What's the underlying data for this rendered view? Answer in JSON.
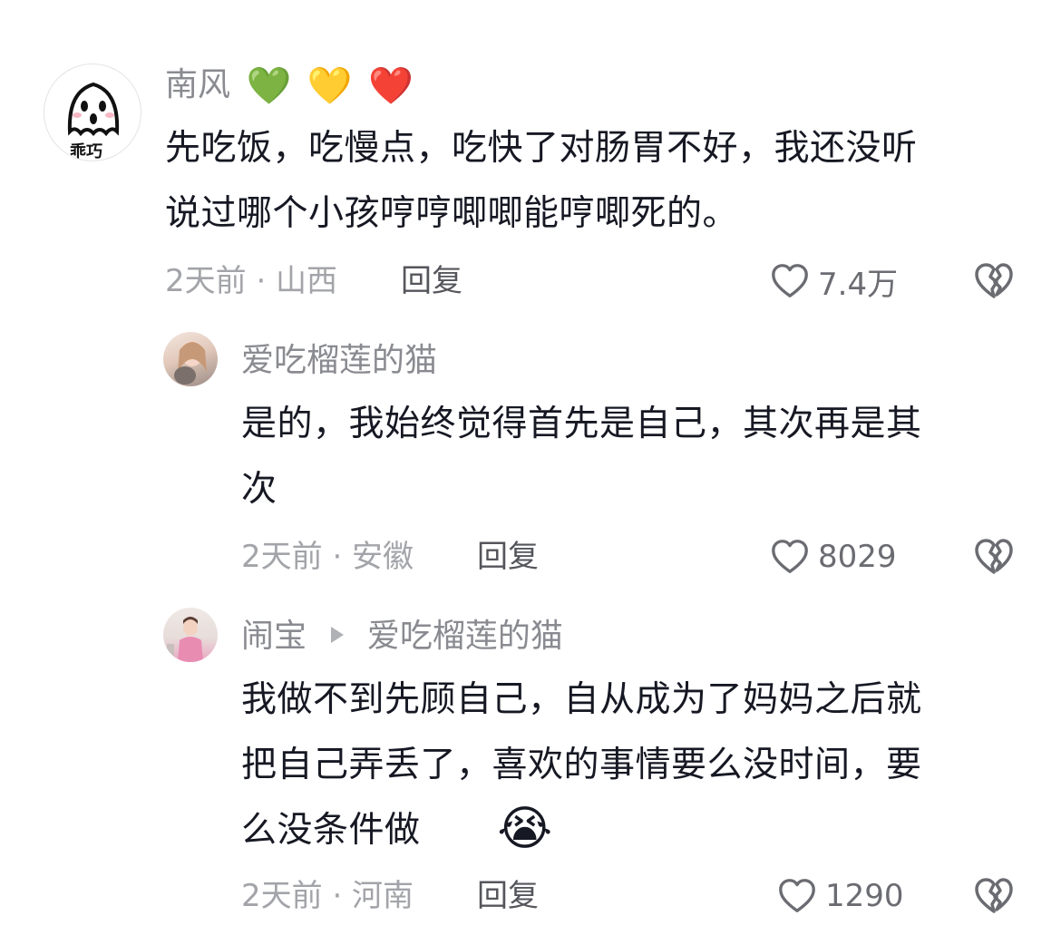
{
  "comments": [
    {
      "author": "南风",
      "author_badges": [
        "💚",
        "💛",
        "❤️"
      ],
      "avatar_icon": "ghost-icon",
      "avatar_text": "乖巧",
      "text_lines": [
        "先吃饭，吃慢点，吃快了对肠胃不好，我还没听",
        "说过哪个小孩哼哼唧唧能哼唧死的。"
      ],
      "time_location": "2天前 · 山西",
      "reply_label": "回复",
      "likes": "7.4万"
    },
    {
      "author": "爱吃榴莲的猫",
      "avatar_icon": "user-photo-avatar",
      "text_lines": [
        "是的，我始终觉得首先是自己，其次再是其",
        "次"
      ],
      "time_location": "2天前 · 安徽",
      "reply_label": "回复",
      "likes": "8029"
    },
    {
      "author": "闹宝",
      "reply_to": "爱吃榴莲的猫",
      "avatar_icon": "user-photo-avatar",
      "text_lines": [
        "我做不到先顾自己，自从成为了妈妈之后就",
        "把自己弄丢了，喜欢的事情要么没时间，要",
        "么没条件做"
      ],
      "text_emoji": "😭",
      "time_location": "2天前 · 河南",
      "reply_label": "回复",
      "likes": "1290"
    }
  ],
  "colors": {
    "author": "#8a8b91",
    "meta": "#a3a4a9",
    "reply": "#55565c",
    "text": "#161823"
  }
}
